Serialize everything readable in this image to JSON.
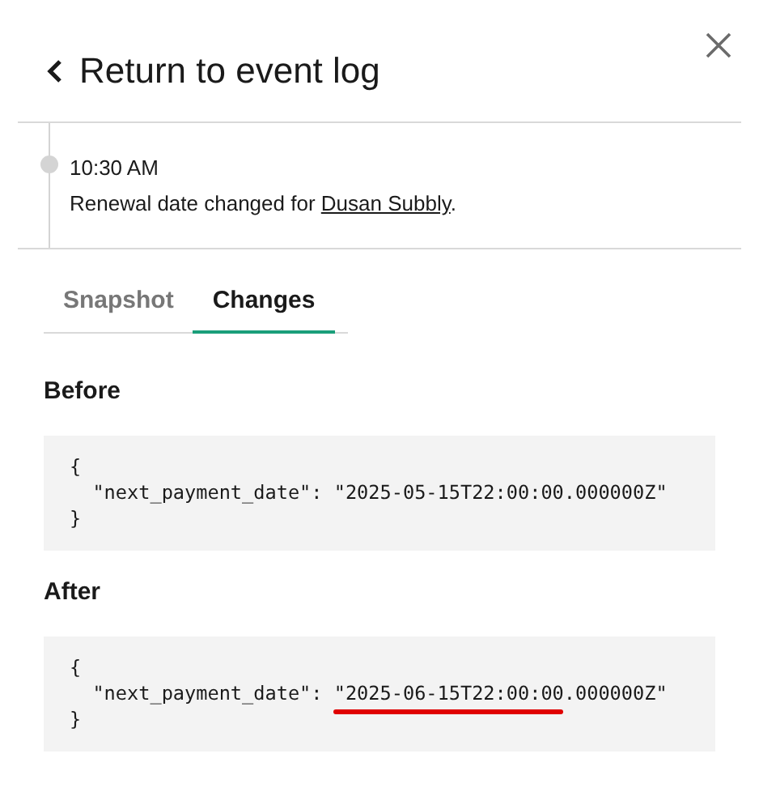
{
  "header": {
    "back_label": "Return to event log"
  },
  "event": {
    "time": "10:30 AM",
    "description": "Renewal date changed for ",
    "link": "Dusan Subbly",
    "suffix": "."
  },
  "tabs": [
    {
      "label": "Snapshot",
      "selected": false
    },
    {
      "label": "Changes",
      "selected": true
    }
  ],
  "sections": [
    {
      "title": "Before",
      "code": [
        "{",
        "  \"next_payment_date\": \"2025-05-15T22:00:00.000000Z\"",
        "}"
      ],
      "highlighted": false
    },
    {
      "title": "After",
      "code": [
        "{",
        "  \"next_payment_date\": \"2025-06-15T22:00:00.000000Z\"",
        "}"
      ],
      "highlighted": true
    }
  ]
}
